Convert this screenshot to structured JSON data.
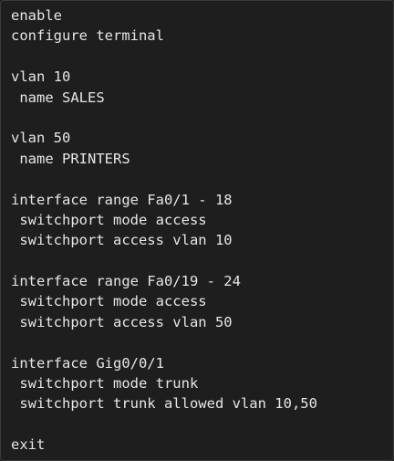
{
  "code": {
    "lines": [
      "enable",
      "configure terminal",
      "",
      "vlan 10",
      " name SALES",
      "",
      "vlan 50",
      " name PRINTERS",
      "",
      "interface range Fa0/1 - 18",
      " switchport mode access",
      " switchport access vlan 10",
      "",
      "interface range Fa0/19 - 24",
      " switchport mode access",
      " switchport access vlan 50",
      "",
      "interface Gig0/0/1",
      " switchport mode trunk",
      " switchport trunk allowed vlan 10,50",
      "",
      "exit"
    ]
  },
  "colors": {
    "background": "#1e1e1e",
    "text": "#e6e6e6",
    "border": "#3a3a3a"
  }
}
